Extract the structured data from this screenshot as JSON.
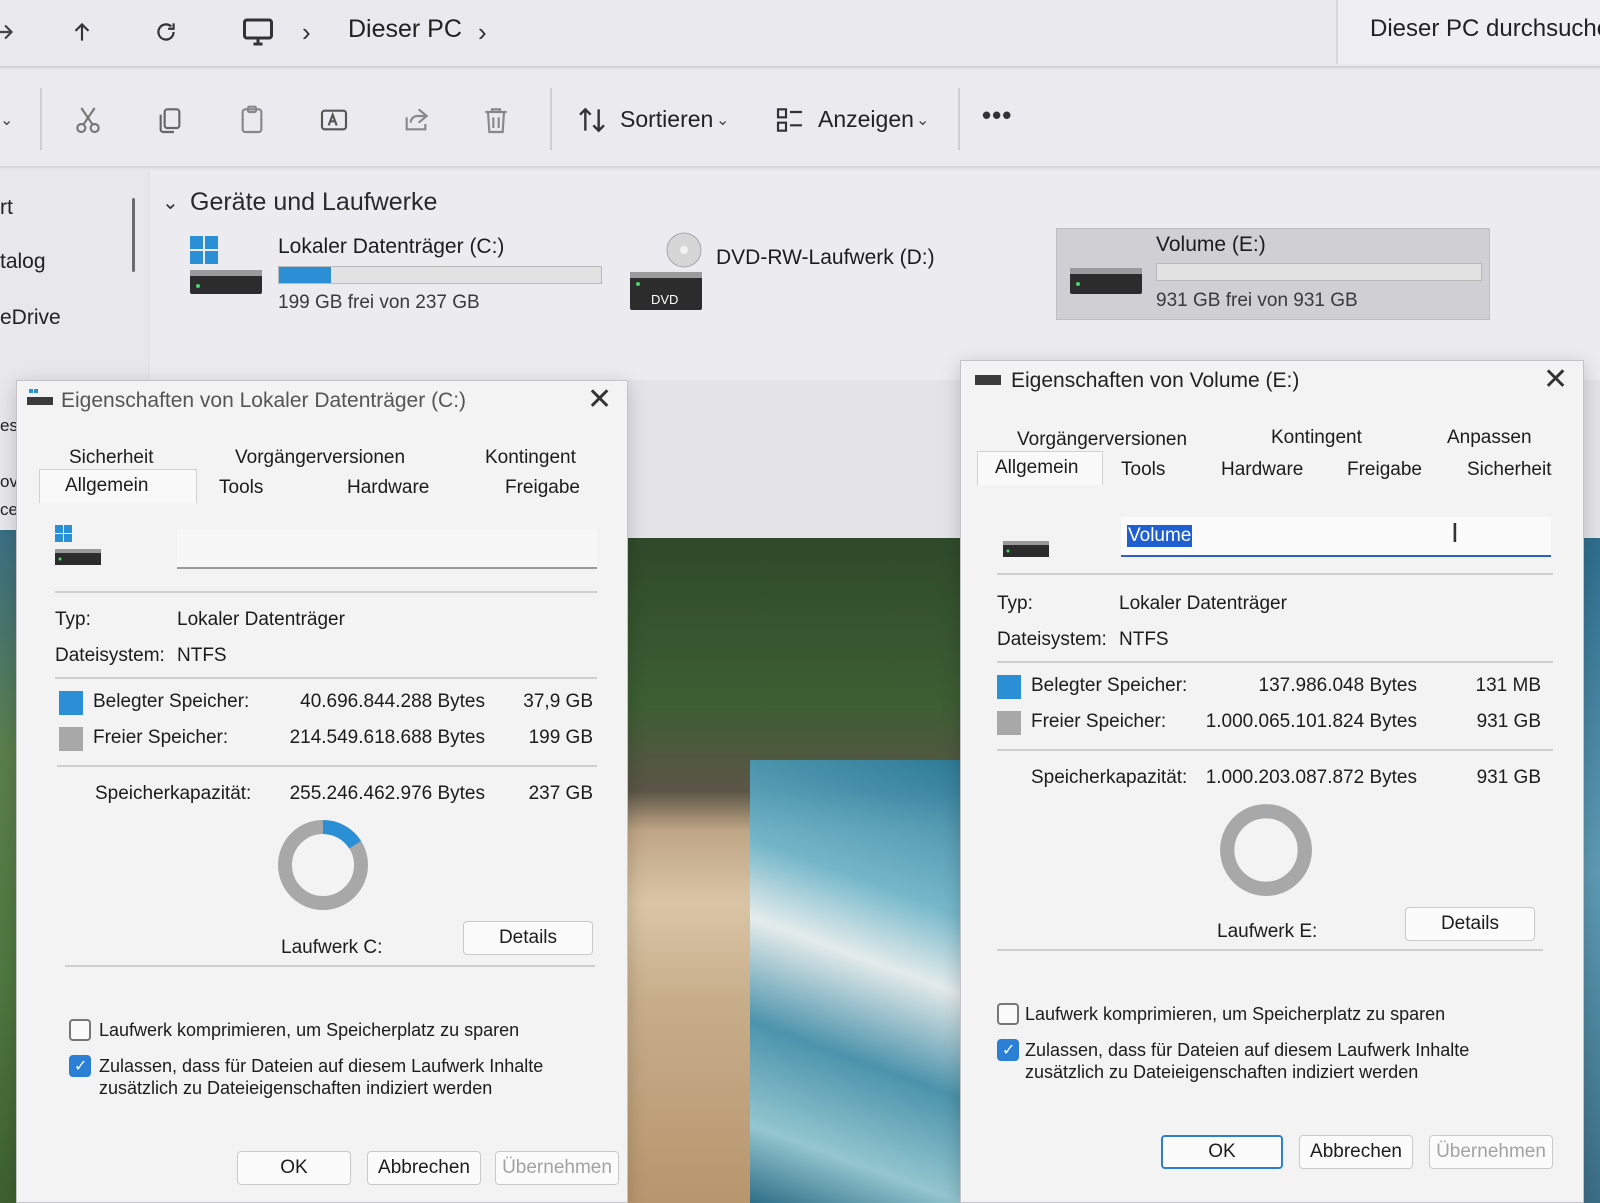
{
  "addressbar": {
    "location": "Dieser PC",
    "search_placeholder": "Dieser PC durchsuche"
  },
  "toolbar": {
    "sort_label": "Sortieren",
    "view_label": "Anzeigen",
    "more_label": "•••"
  },
  "sidebar": {
    "items": [
      "rt",
      "talog",
      "eDrive",
      "es",
      "ov",
      "ce"
    ]
  },
  "devices": {
    "heading": "Geräte und Laufwerke",
    "drives": [
      {
        "name": "Lokaler Datenträger (C:)",
        "free_text": "199 GB frei von 237 GB",
        "used_fraction": 0.16
      },
      {
        "name": "DVD-RW-Laufwerk (D:)",
        "badge": "DVD"
      },
      {
        "name": "Volume (E:)",
        "free_text": "931 GB frei von 931 GB",
        "used_fraction": 0.0
      }
    ]
  },
  "dialog_c": {
    "title": "Eigenschaften von Lokaler Datenträger (C:)",
    "tabs_row1": [
      "Sicherheit",
      "Vorgängerversionen",
      "Kontingent"
    ],
    "tabs_row2": [
      "Allgemein",
      "Tools",
      "Hardware",
      "Freigabe"
    ],
    "name_value": "",
    "type_label": "Typ:",
    "type_value": "Lokaler Datenträger",
    "fs_label": "Dateisystem:",
    "fs_value": "NTFS",
    "used_label": "Belegter Speicher:",
    "used_bytes": "40.696.844.288 Bytes",
    "used_short": "37,9 GB",
    "free_label": "Freier Speicher:",
    "free_bytes": "214.549.618.688 Bytes",
    "free_short": "199 GB",
    "cap_label": "Speicherkapazität:",
    "cap_bytes": "255.246.462.976 Bytes",
    "cap_short": "237 GB",
    "used_fraction": 0.16,
    "drive_label": "Laufwerk C:",
    "details_button": "Details",
    "compress_label": "Laufwerk komprimieren, um Speicherplatz zu sparen",
    "compress_checked": false,
    "index_label_1": "Zulassen, dass für Dateien auf diesem Laufwerk Inhalte",
    "index_label_2": "zusätzlich zu Dateieigenschaften indiziert werden",
    "index_checked": true,
    "ok_button": "OK",
    "cancel_button": "Abbrechen",
    "apply_button": "Übernehmen"
  },
  "dialog_e": {
    "title": "Eigenschaften von Volume (E:)",
    "tabs_row1": [
      "Vorgängerversionen",
      "Kontingent",
      "Anpassen"
    ],
    "tabs_row2": [
      "Allgemein",
      "Tools",
      "Hardware",
      "Freigabe",
      "Sicherheit"
    ],
    "name_value": "Volume",
    "type_label": "Typ:",
    "type_value": "Lokaler Datenträger",
    "fs_label": "Dateisystem:",
    "fs_value": "NTFS",
    "used_label": "Belegter Speicher:",
    "used_bytes": "137.986.048 Bytes",
    "used_short": "131 MB",
    "free_label": "Freier Speicher:",
    "free_bytes": "1.000.065.101.824 Bytes",
    "free_short": "931 GB",
    "cap_label": "Speicherkapazität:",
    "cap_bytes": "1.000.203.087.872 Bytes",
    "cap_short": "931 GB",
    "used_fraction": 0.0001,
    "drive_label": "Laufwerk E:",
    "details_button": "Details",
    "compress_label": "Laufwerk komprimieren, um Speicherplatz zu sparen",
    "compress_checked": false,
    "index_label_1": "Zulassen, dass für Dateien auf diesem Laufwerk Inhalte",
    "index_label_2": "zusätzlich zu Dateieigenschaften indiziert werden",
    "index_checked": true,
    "ok_button": "OK",
    "cancel_button": "Abbrechen",
    "apply_button": "Übernehmen"
  },
  "colors": {
    "used": "#2b8fd6",
    "free": "#a8a8a8",
    "accent": "#2b7fd4"
  }
}
